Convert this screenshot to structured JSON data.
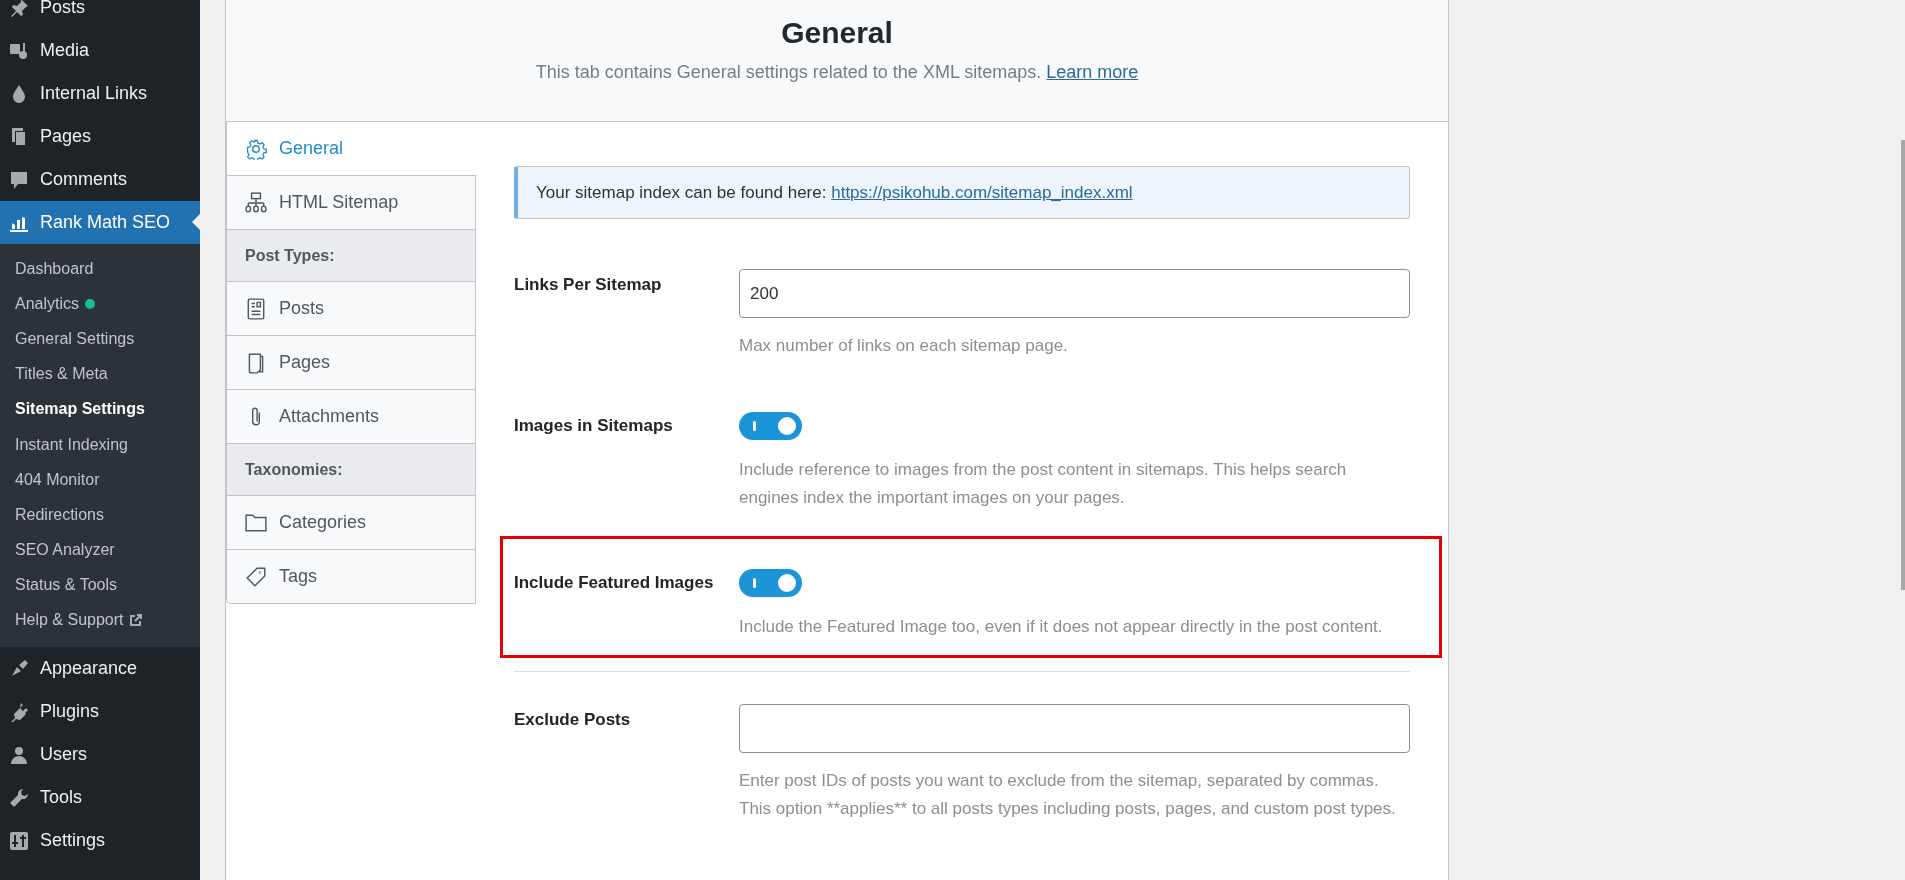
{
  "sidebar": {
    "menu": [
      {
        "label": "Posts",
        "selected": false
      },
      {
        "label": "Media",
        "selected": false
      },
      {
        "label": "Internal Links",
        "selected": false
      },
      {
        "label": "Pages",
        "selected": false
      },
      {
        "label": "Comments",
        "selected": false
      },
      {
        "label": "Rank Math SEO",
        "selected": true,
        "children": [
          {
            "label": "Dashboard",
            "selected": false
          },
          {
            "label": "Analytics",
            "selected": false,
            "color": "#1dbf8e"
          },
          {
            "label": "General Settings",
            "selected": false
          },
          {
            "label": "Titles & Meta",
            "selected": false
          },
          {
            "label": "Sitemap Settings",
            "selected": true
          },
          {
            "label": "Instant Indexing",
            "selected": false
          },
          {
            "label": "404 Monitor",
            "selected": false
          },
          {
            "label": "Redirections",
            "selected": false
          },
          {
            "label": "SEO Analyzer",
            "selected": false
          },
          {
            "label": "Status & Tools",
            "selected": false
          },
          {
            "label": "Help & Support",
            "selected": false,
            "external": true
          }
        ]
      },
      {
        "label": "Appearance",
        "selected": false
      },
      {
        "label": "Plugins",
        "selected": false
      },
      {
        "label": "Users",
        "selected": false
      },
      {
        "label": "Tools",
        "selected": false
      },
      {
        "label": "Settings",
        "selected": false
      }
    ]
  },
  "header": {
    "title": "General",
    "description": "This tab contains General settings related to the XML sitemaps.",
    "link": "Learn more"
  },
  "tabs": [
    {
      "kind": "tab",
      "label": "General",
      "selected": true
    },
    {
      "kind": "tab",
      "label": "HTML Sitemap",
      "selected": false
    },
    {
      "kind": "group",
      "label": "Post Types:"
    },
    {
      "kind": "tab",
      "label": "Posts",
      "selected": false
    },
    {
      "kind": "tab",
      "label": "Pages",
      "selected": false
    },
    {
      "kind": "tab",
      "label": "Attachments",
      "selected": false
    },
    {
      "kind": "group",
      "label": "Taxonomies:"
    },
    {
      "kind": "tab",
      "label": "Categories",
      "selected": false
    },
    {
      "kind": "tab",
      "label": "Tags",
      "selected": false
    }
  ],
  "notice": {
    "text": "Your sitemap index can be found here:",
    "link": "https://psikohub.com/sitemap_index.xml"
  },
  "settings": [
    {
      "kind": "text",
      "label": "Links Per Sitemap",
      "value": "200",
      "description": "Max number of links on each sitemap page.",
      "highlighted": false
    },
    {
      "kind": "toggle",
      "label": "Images in Sitemaps",
      "on": true,
      "description": "Include reference to images from the post content in sitemaps. This helps search engines index the important images on your pages.",
      "highlighted": false
    },
    {
      "kind": "toggle",
      "label": "Include Featured Images",
      "on": true,
      "description": "Include the Featured Image too, even if it does not appear directly in the post content.",
      "highlighted": true
    },
    {
      "kind": "text",
      "label": "Exclude Posts",
      "description": "Enter post IDs of posts you want to exclude from the sitemap, separated by commas. This option **applies** to all posts types including posts, pages, and custom post types.",
      "highlighted": false
    }
  ]
}
